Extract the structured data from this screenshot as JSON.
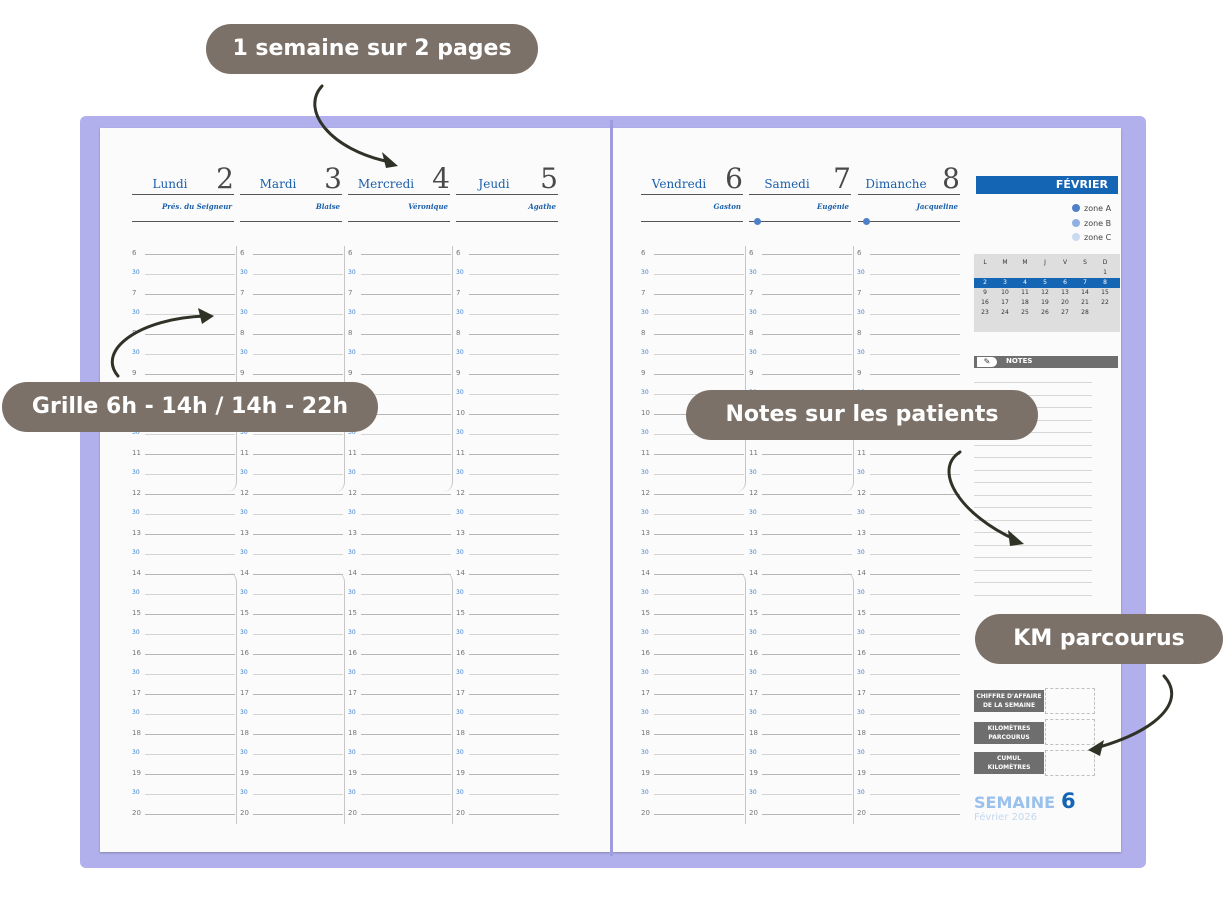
{
  "callouts": {
    "semaine": "1 semaine sur 2 pages",
    "grille": "Grille 6h - 14h / 14h - 22h",
    "notes": "Notes sur les patients",
    "km": "KM parcourus"
  },
  "days": [
    {
      "name": "Lundi",
      "num": "2",
      "saint": "Prés. du Seigneur"
    },
    {
      "name": "Mardi",
      "num": "3",
      "saint": "Blaise"
    },
    {
      "name": "Mercredi",
      "num": "4",
      "saint": "Véronique"
    },
    {
      "name": "Jeudi",
      "num": "5",
      "saint": "Agathe"
    },
    {
      "name": "Vendredi",
      "num": "6",
      "saint": "Gaston"
    },
    {
      "name": "Samedi",
      "num": "7",
      "saint": "Eugénie"
    },
    {
      "name": "Dimanche",
      "num": "8",
      "saint": "Jacqueline"
    }
  ],
  "hours": [
    "6",
    "7",
    "8",
    "9",
    "10",
    "11",
    "12",
    "13",
    "14",
    "15",
    "16",
    "17",
    "18",
    "19",
    "20"
  ],
  "half_label": "30",
  "sidebar": {
    "month": "FÉVRIER",
    "zones": [
      {
        "label": "zone A",
        "color": "#4e7fc8"
      },
      {
        "label": "zone B",
        "color": "#8fb0e0"
      },
      {
        "label": "zone C",
        "color": "#c9daf2"
      }
    ],
    "calendar": {
      "weekdays": [
        "L",
        "M",
        "M",
        "J",
        "V",
        "S",
        "D"
      ],
      "weeks": [
        [
          "",
          "",
          "",
          "",
          "",
          "",
          "1"
        ],
        [
          "2",
          "3",
          "4",
          "5",
          "6",
          "7",
          "8"
        ],
        [
          "9",
          "10",
          "11",
          "12",
          "13",
          "14",
          "15"
        ],
        [
          "16",
          "17",
          "18",
          "19",
          "20",
          "21",
          "22"
        ],
        [
          "23",
          "24",
          "25",
          "26",
          "27",
          "28",
          ""
        ]
      ],
      "highlight_week": 1
    },
    "notes_title": "NOTES",
    "boxes": [
      {
        "line1": "CHIFFRE D'AFFAIRE",
        "line2": "DE LA SEMAINE"
      },
      {
        "line1": "KILOMÈTRES",
        "line2": "PARCOURUS"
      },
      {
        "line1": "CUMUL",
        "line2": "KILOMÈTRES"
      }
    ],
    "semaine_label": "SEMAINE",
    "semaine_num": "6",
    "semaine_sub": "Février 2026"
  },
  "colors": {
    "cover": "#b1b0ec",
    "accent": "#1565b5",
    "callout": "#7c7168"
  }
}
